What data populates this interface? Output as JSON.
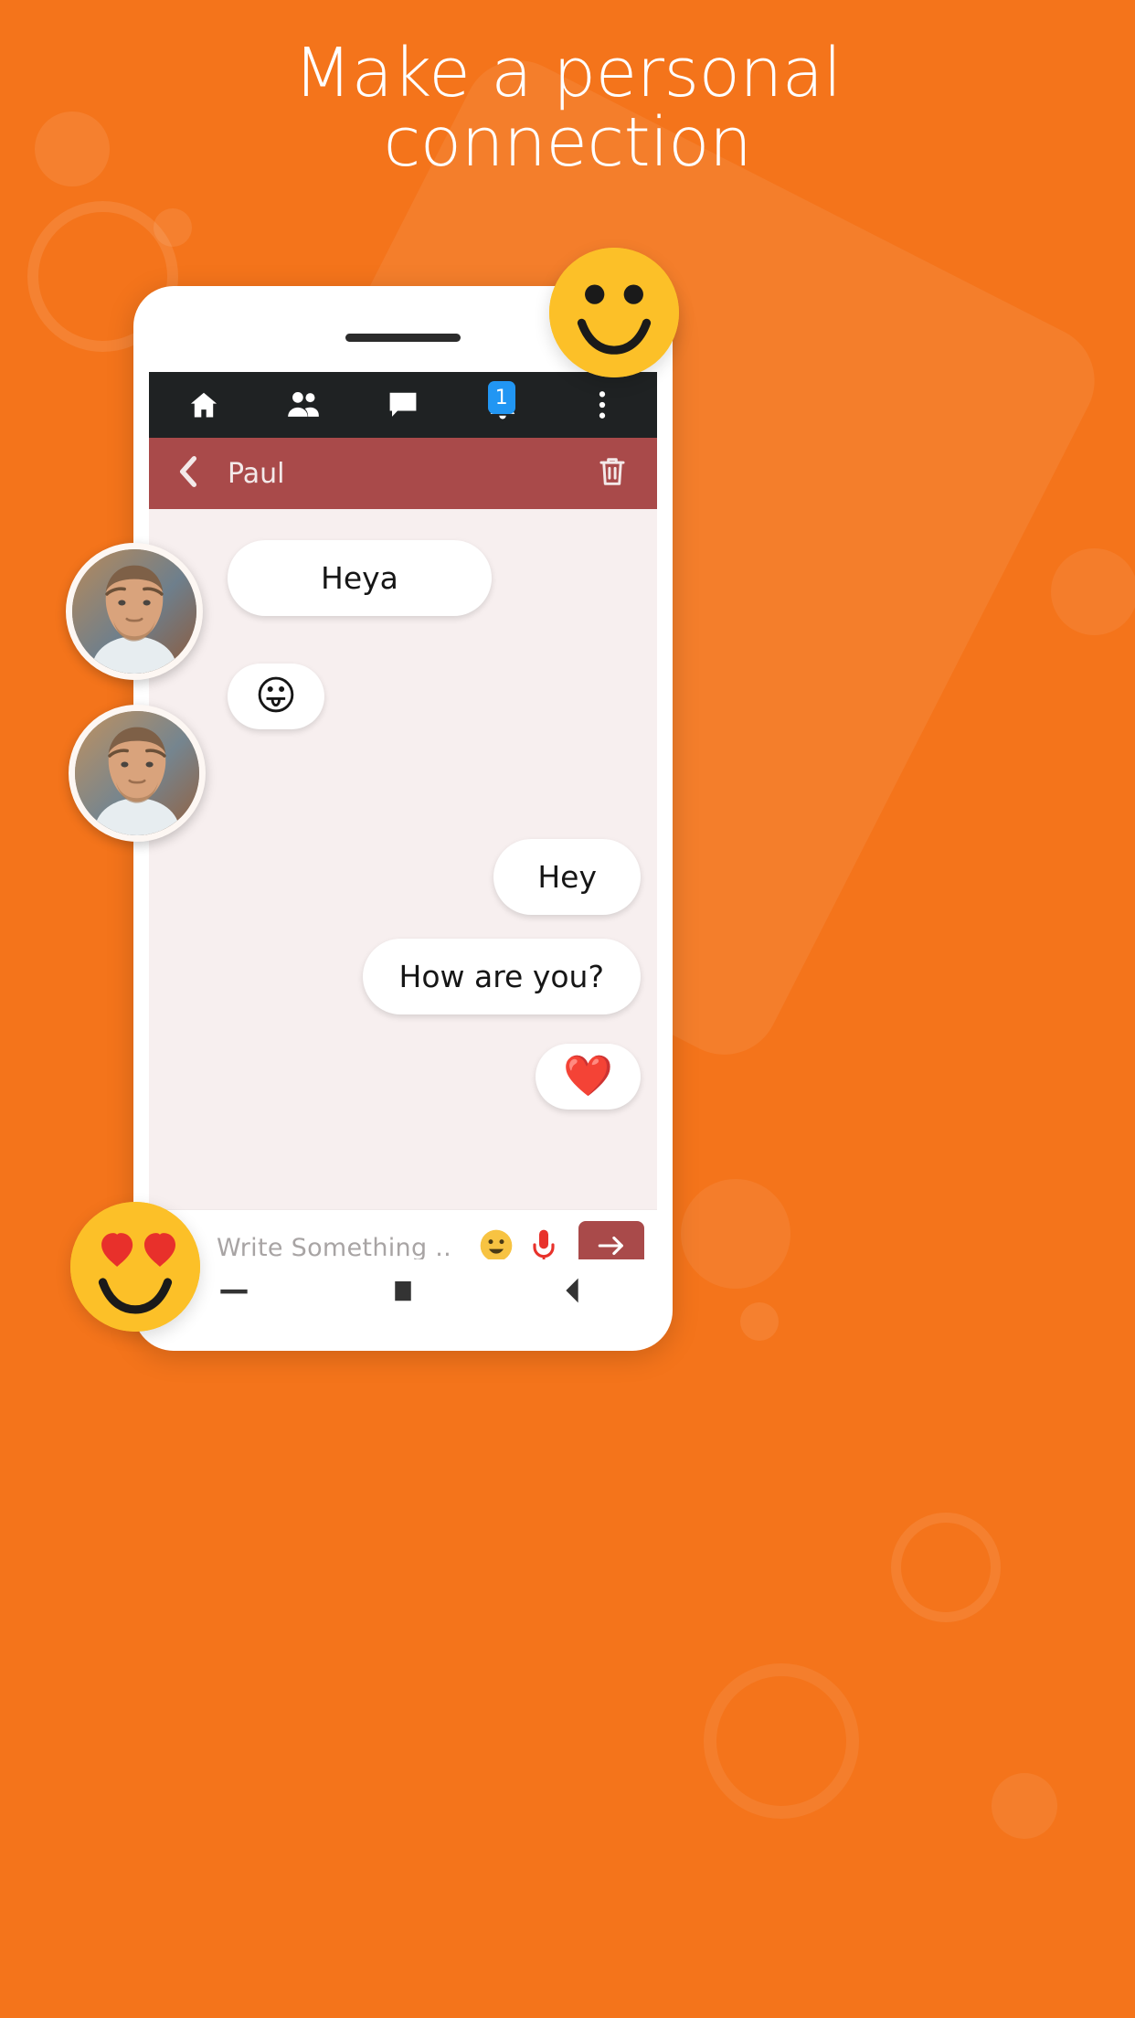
{
  "page": {
    "background_color": "#F4741B",
    "headline_line1": "Make a personal",
    "headline_line2": "connection"
  },
  "app_nav": {
    "items": [
      {
        "name": "home",
        "icon": "home-icon",
        "badge": null
      },
      {
        "name": "friends",
        "icon": "people-icon",
        "badge": null
      },
      {
        "name": "messages",
        "icon": "chat-bubble-icon",
        "badge": null
      },
      {
        "name": "notifications",
        "icon": "bell-icon",
        "badge": "1"
      },
      {
        "name": "more",
        "icon": "kebab-menu-icon",
        "badge": null
      }
    ],
    "badge_color": "#2196F3",
    "bar_color": "#1F2223"
  },
  "chat_header": {
    "back_icon": "chevron-left-icon",
    "title": "Paul",
    "delete_icon": "trash-icon",
    "bar_color": "#A94A4A"
  },
  "conversation": {
    "messages": [
      {
        "side": "left",
        "type": "text",
        "text": "Heya"
      },
      {
        "side": "left",
        "type": "emoji",
        "text": "😛"
      },
      {
        "side": "right",
        "type": "text",
        "text": "Hey"
      },
      {
        "side": "right",
        "type": "text",
        "text": "How are you?"
      },
      {
        "side": "right",
        "type": "emoji",
        "text": "❤️"
      }
    ],
    "avatars": [
      {
        "name": "avatar-paul-1"
      },
      {
        "name": "avatar-paul-2"
      }
    ],
    "background_color": "#F7EFEF"
  },
  "input_bar": {
    "attach_icon": "file-attachment-icon",
    "placeholder": "Write Something ..",
    "emoji_icon": "smiley-icon",
    "mic_icon": "microphone-icon",
    "send_icon": "arrow-right-icon",
    "send_color": "#A94A4A"
  },
  "system_nav": {
    "items": [
      {
        "name": "minimize",
        "icon": "dash-icon"
      },
      {
        "name": "recents",
        "icon": "square-icon"
      },
      {
        "name": "back",
        "icon": "triangle-back-icon"
      }
    ]
  },
  "floating_stickers": [
    {
      "name": "smiley-sticker",
      "icon": "smiley-face-sticker"
    },
    {
      "name": "heart-eyes-sticker",
      "icon": "heart-eyes-sticker"
    }
  ]
}
